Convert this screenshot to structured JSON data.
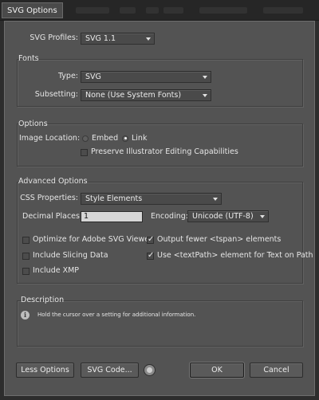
{
  "window": {
    "title": "SVG Options"
  },
  "svg_profiles": {
    "label": "SVG Profiles:",
    "value": "SVG 1.1"
  },
  "fonts": {
    "title": "Fonts",
    "type_label": "Type:",
    "type_value": "SVG",
    "subsetting_label": "Subsetting:",
    "subsetting_value": "None (Use System Fonts)"
  },
  "options": {
    "title": "Options",
    "image_location_label": "Image Location:",
    "embed_label": "Embed",
    "link_label": "Link",
    "selected": "Link",
    "preserve_label": "Preserve Illustrator Editing Capabilities",
    "preserve_checked": false
  },
  "advanced": {
    "title": "Advanced Options",
    "css_label": "CSS Properties:",
    "css_value": "Style Elements",
    "decimal_label": "Decimal Places:",
    "decimal_value": "1",
    "encoding_label": "Encoding:",
    "encoding_value": "Unicode (UTF-8)",
    "checkboxes": [
      {
        "label": "Optimize for Adobe SVG Viewer",
        "checked": false
      },
      {
        "label": "Include Slicing Data",
        "checked": false
      },
      {
        "label": "Include XMP",
        "checked": false
      },
      {
        "label": "Output fewer <tspan> elements",
        "checked": true
      },
      {
        "label": "Use <textPath> element for Text on Path",
        "checked": true
      }
    ]
  },
  "description": {
    "title": "Description",
    "text": "Hold the cursor over a setting for additional information."
  },
  "buttons": {
    "less_options": "Less Options",
    "svg_code": "SVG Code...",
    "ok": "OK",
    "cancel": "Cancel"
  },
  "icons": {
    "info": "info-icon",
    "globe": "globe-icon",
    "dropdown": "chevron-down-icon"
  }
}
